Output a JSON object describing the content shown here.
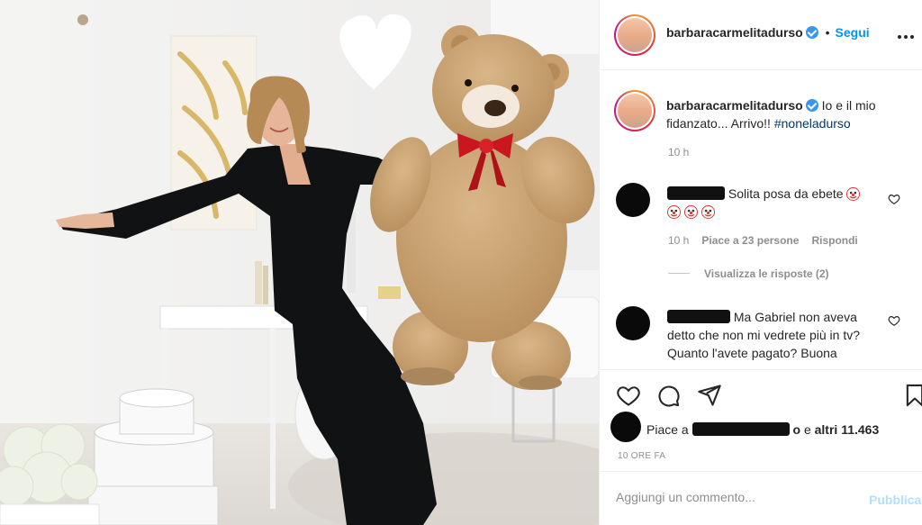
{
  "post": {
    "author": "barbaracarmelitadurso",
    "follow_label": "Segui",
    "caption_text": " Io e il mio fidanzato... Arrivo!! ",
    "caption_hashtag": "#noneladurso",
    "caption_time": "10 h"
  },
  "comments": [
    {
      "text": "Solita posa da ebete",
      "emoji_count": 4,
      "time": "10 h",
      "likes": "Piace a 23 persone",
      "reply_label": "Rispondi",
      "view_replies": "Visualizza le risposte (2)"
    },
    {
      "text": "Ma Gabriel non aveva detto che non mi vedrete più in tv? Quanto l'avete pagato? Buona"
    }
  ],
  "likes": {
    "prefix": "Piace a",
    "middle": "e",
    "count": "altri 11.463"
  },
  "post_time": "10 ORE FA",
  "add_comment": {
    "placeholder": "Aggiungi un commento...",
    "publish_label": "Pubblica"
  },
  "colors": {
    "link_blue": "#0095f6",
    "hashtag": "#00376b",
    "muted": "#8e8e8e",
    "publish_disabled": "#b2dffc"
  },
  "icons": [
    "more-icon",
    "verified-icon",
    "heart-icon",
    "comment-icon",
    "share-icon",
    "bookmark-icon",
    "clown-emoji"
  ]
}
